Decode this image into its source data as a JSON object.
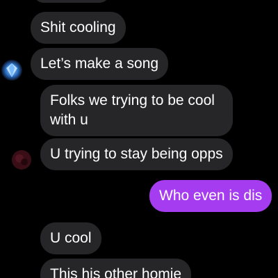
{
  "conversation": {
    "messages": [
      {
        "sender": "them",
        "text": "Shit cooling"
      },
      {
        "sender": "them",
        "text": "Let’s make a song"
      },
      {
        "sender": "them",
        "text": "Folks we trying to be cool\nwith u"
      },
      {
        "sender": "them",
        "text": "U trying to stay being opps"
      },
      {
        "sender": "me",
        "text": "Who even is dis"
      },
      {
        "sender": "them",
        "text": "U cool"
      },
      {
        "sender": "them",
        "text": "This his other homie"
      }
    ]
  },
  "colors": {
    "background": "#000000",
    "incoming_bubble": "#262628",
    "outgoing_bubble": "#a53cf0",
    "text": "#ffffff"
  },
  "icons": {
    "sender_avatar_1": "blue-diamond-avatar-icon",
    "sender_avatar_2": "dark-red-avatar-icon"
  }
}
